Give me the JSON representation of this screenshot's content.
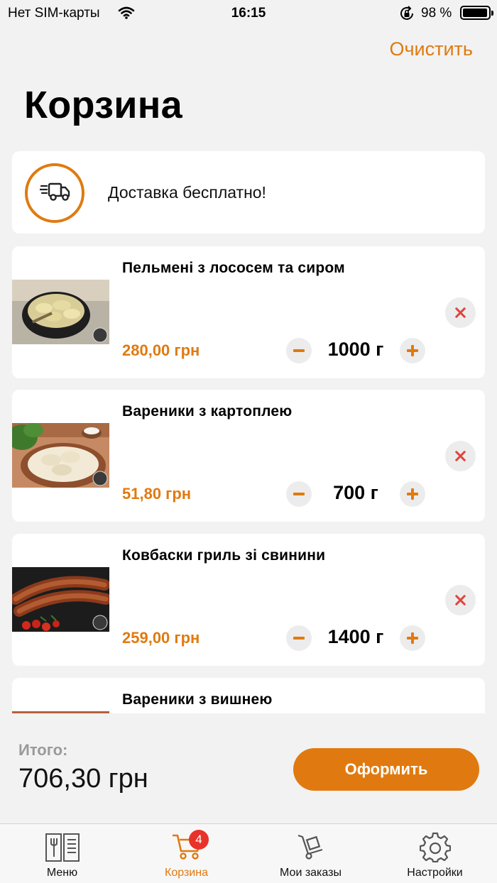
{
  "status_bar": {
    "carrier": "Нет SIM-карты",
    "time": "16:15",
    "battery_percent": "98 %",
    "battery_level": 0.98
  },
  "header": {
    "clear_label": "Очистить",
    "title": "Корзина"
  },
  "delivery": {
    "icon": "delivery-truck-icon",
    "text": "Доставка бесплатно!"
  },
  "cart": {
    "items": [
      {
        "name": "Пельмені з лососем та сиром",
        "price": "280,00 грн",
        "quantity": "1000 г",
        "image": "dumplings-salmon-photo"
      },
      {
        "name": "Вареники з картоплею",
        "price": "51,80 грн",
        "quantity": "700 г",
        "image": "vareniki-potato-photo"
      },
      {
        "name": "Ковбаски гриль зі свинини",
        "price": "259,00 грн",
        "quantity": "1400 г",
        "image": "grilled-sausages-photo"
      },
      {
        "name": "Вареники з вишнею",
        "price": "",
        "quantity": "",
        "image": "vareniki-cherry-photo"
      }
    ]
  },
  "summary": {
    "total_label": "Итого:",
    "total_value": "706,30 грн",
    "checkout_label": "Оформить"
  },
  "tab_bar": {
    "tabs": [
      {
        "label": "Меню",
        "icon": "menu-book-icon",
        "active": false
      },
      {
        "label": "Корзина",
        "icon": "cart-icon",
        "active": true,
        "badge": "4"
      },
      {
        "label": "Мои заказы",
        "icon": "hand-truck-icon",
        "active": false
      },
      {
        "label": "Настройки",
        "icon": "gear-icon",
        "active": false
      }
    ]
  },
  "colors": {
    "accent": "#e07a10",
    "remove": "#e0453e",
    "badge": "#e8332a",
    "background": "#f2f2f2"
  }
}
